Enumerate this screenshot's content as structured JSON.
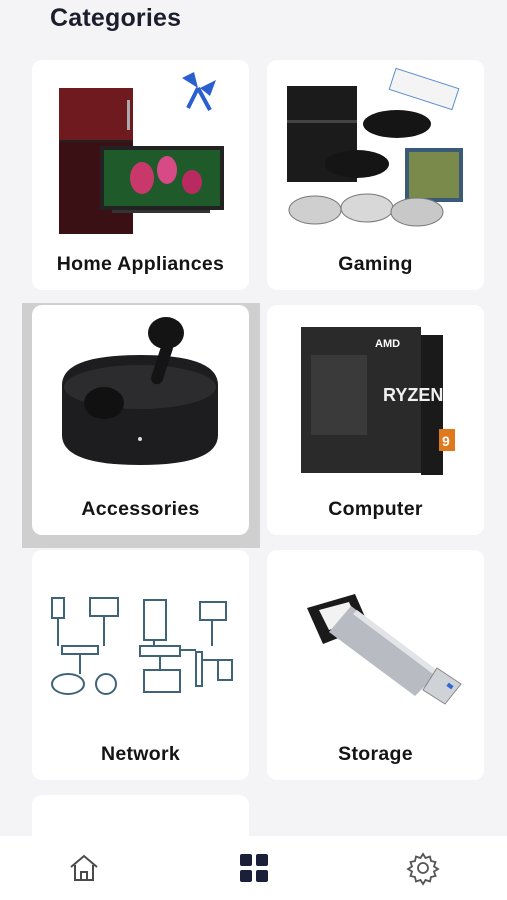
{
  "header": {
    "title": "Categories"
  },
  "categories": [
    {
      "label": "Home Appliances",
      "icon": "fridge-tv-image"
    },
    {
      "label": "Gaming",
      "icon": "game-console-image"
    },
    {
      "label": "Accessories",
      "icon": "earbuds-image"
    },
    {
      "label": "Computer",
      "icon": "cpu-box-image"
    },
    {
      "label": "Network",
      "icon": "network-diagram-image"
    },
    {
      "label": "Storage",
      "icon": "usb-drive-image"
    }
  ],
  "bottom_nav": [
    {
      "name": "home",
      "icon": "home-icon"
    },
    {
      "name": "categories",
      "icon": "grid-icon",
      "active": true
    },
    {
      "name": "settings",
      "icon": "gear-icon"
    }
  ],
  "colors": {
    "nav_active": "#1c1f3a",
    "nav_inactive": "#555555"
  }
}
